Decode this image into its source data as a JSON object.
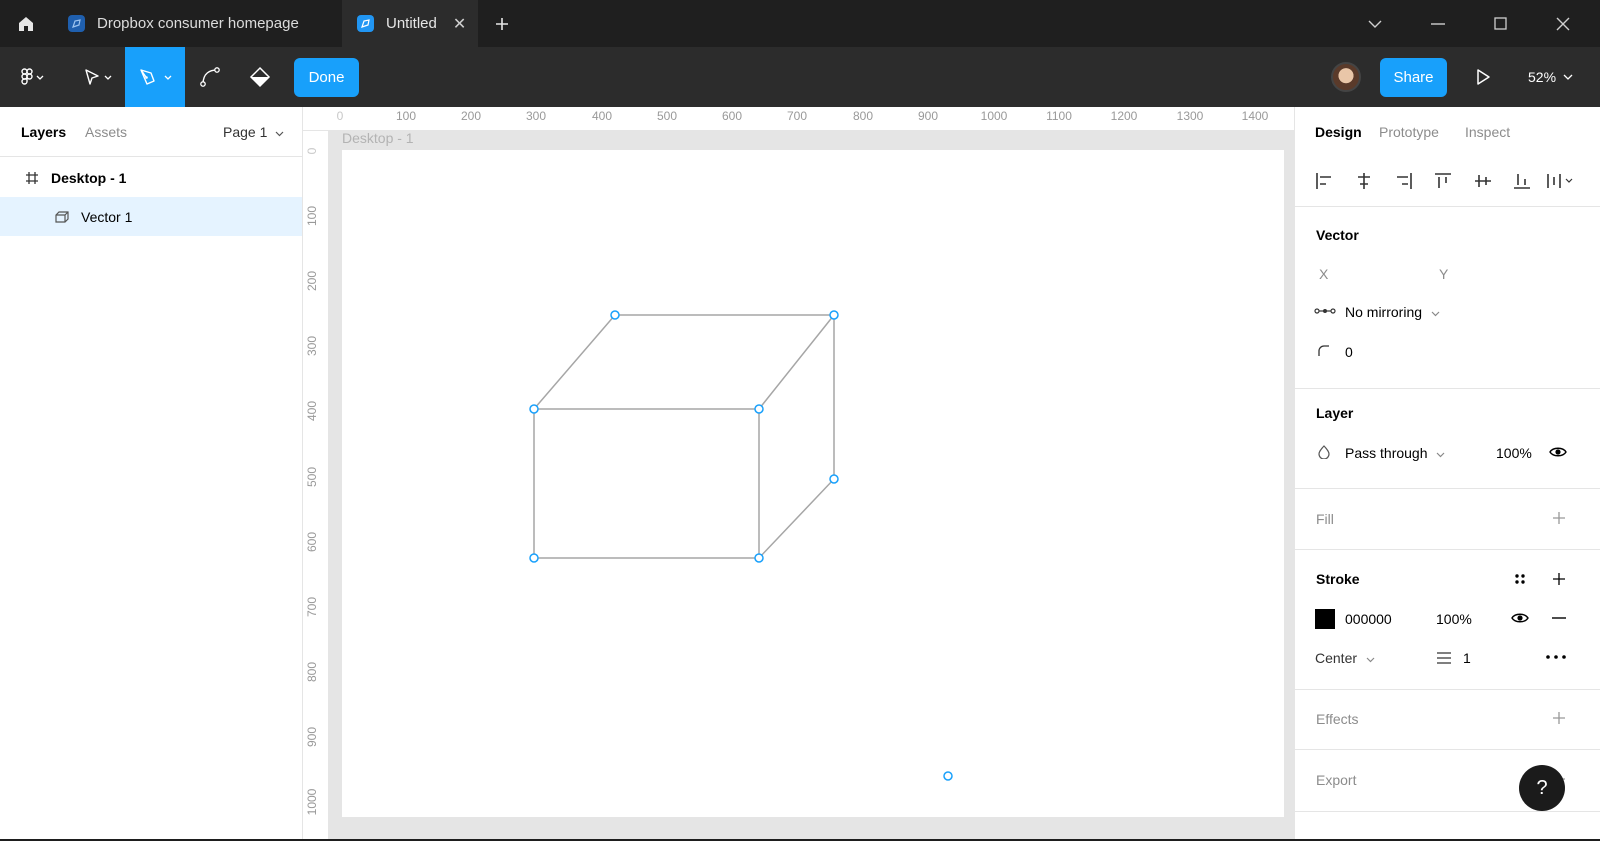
{
  "tabs": [
    {
      "label": "Dropbox consumer homepage"
    },
    {
      "label": "Untitled"
    }
  ],
  "toolbar": {
    "done_label": "Done",
    "share_label": "Share",
    "zoom": "52%"
  },
  "left_panel": {
    "tab_layers": "Layers",
    "tab_assets": "Assets",
    "page_selector": "Page 1",
    "layers": [
      {
        "label": "Desktop - 1"
      },
      {
        "label": "Vector 1"
      }
    ]
  },
  "canvas": {
    "frame_label": "Desktop - 1",
    "ruler_h": [
      "0",
      "100",
      "200",
      "300",
      "400",
      "500",
      "600",
      "700",
      "800",
      "900",
      "1000",
      "1100",
      "1200",
      "1300",
      "1400"
    ],
    "ruler_v": [
      "0",
      "100",
      "200",
      "300",
      "400",
      "500",
      "600",
      "700",
      "800",
      "900",
      "1000"
    ]
  },
  "right_panel": {
    "tab_design": "Design",
    "tab_prototype": "Prototype",
    "tab_inspect": "Inspect",
    "vector": {
      "title": "Vector",
      "x_label": "X",
      "y_label": "Y",
      "mirroring": "No mirroring",
      "corner_radius": "0"
    },
    "layer": {
      "title": "Layer",
      "blend_mode": "Pass through",
      "opacity": "100%"
    },
    "fill": {
      "title": "Fill"
    },
    "stroke": {
      "title": "Stroke",
      "color_hex": "000000",
      "opacity": "100%",
      "position": "Center",
      "weight": "1"
    },
    "effects": {
      "title": "Effects"
    },
    "export": {
      "title": "Export"
    }
  },
  "help_label": "?",
  "colors": {
    "accent": "#18a0fb",
    "selection": "#e5f3ff"
  }
}
